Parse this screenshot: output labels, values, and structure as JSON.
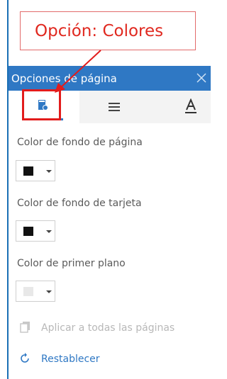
{
  "callout": {
    "text": "Opción: Colores"
  },
  "panel": {
    "title": "Opciones de página",
    "tabs": [
      {
        "name": "colors",
        "icon": "color-page-icon"
      },
      {
        "name": "layout",
        "icon": "lines-icon"
      },
      {
        "name": "text",
        "icon": "font-a-icon"
      }
    ]
  },
  "settings": {
    "page_bg": {
      "label": "Color de fondo de página",
      "color": "#111111"
    },
    "card_bg": {
      "label": "Color de fondo de tarjeta",
      "color": "#111111"
    },
    "foreground": {
      "label": "Color de primer plano",
      "color": "#e8e8e8"
    }
  },
  "actions": {
    "apply_all": "Aplicar a todas las páginas",
    "reset": "Restablecer"
  },
  "colors": {
    "accent": "#2f78c4",
    "highlight": "#e21c1c",
    "callout_text": "#e0281f"
  }
}
